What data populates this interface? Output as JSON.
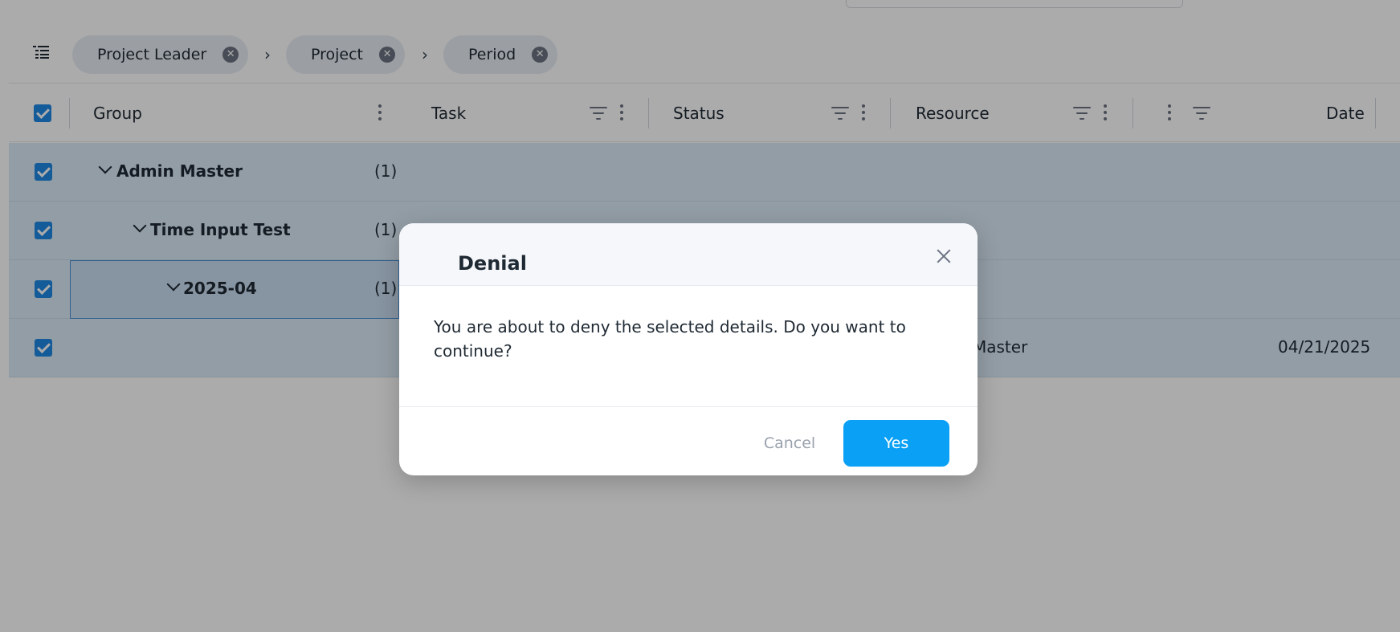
{
  "grouping": {
    "chips": [
      {
        "label": "Project Leader"
      },
      {
        "label": "Project"
      },
      {
        "label": "Period"
      }
    ],
    "remove_glyph": "✕",
    "separator_glyph": "›"
  },
  "grid": {
    "columns": {
      "group": "Group",
      "task": "Task",
      "status": "Status",
      "resource": "Resource",
      "date": "Date"
    },
    "rows": [
      {
        "label": "Admin Master",
        "count": "(1)"
      },
      {
        "label": "Time Input Test",
        "count": "(1)"
      },
      {
        "label": "2025-04",
        "count": "(1)"
      }
    ],
    "detail_row": {
      "resource": "Master",
      "date": "04/21/2025"
    }
  },
  "dialog": {
    "title": "Denial",
    "message": "You are about to deny the selected details. Do you want to continue?",
    "cancel_label": "Cancel",
    "yes_label": "Yes"
  },
  "colors": {
    "accent": "#0aa0f5",
    "checkbox": "#1e88e5",
    "row_selected": "#dcebf7"
  }
}
